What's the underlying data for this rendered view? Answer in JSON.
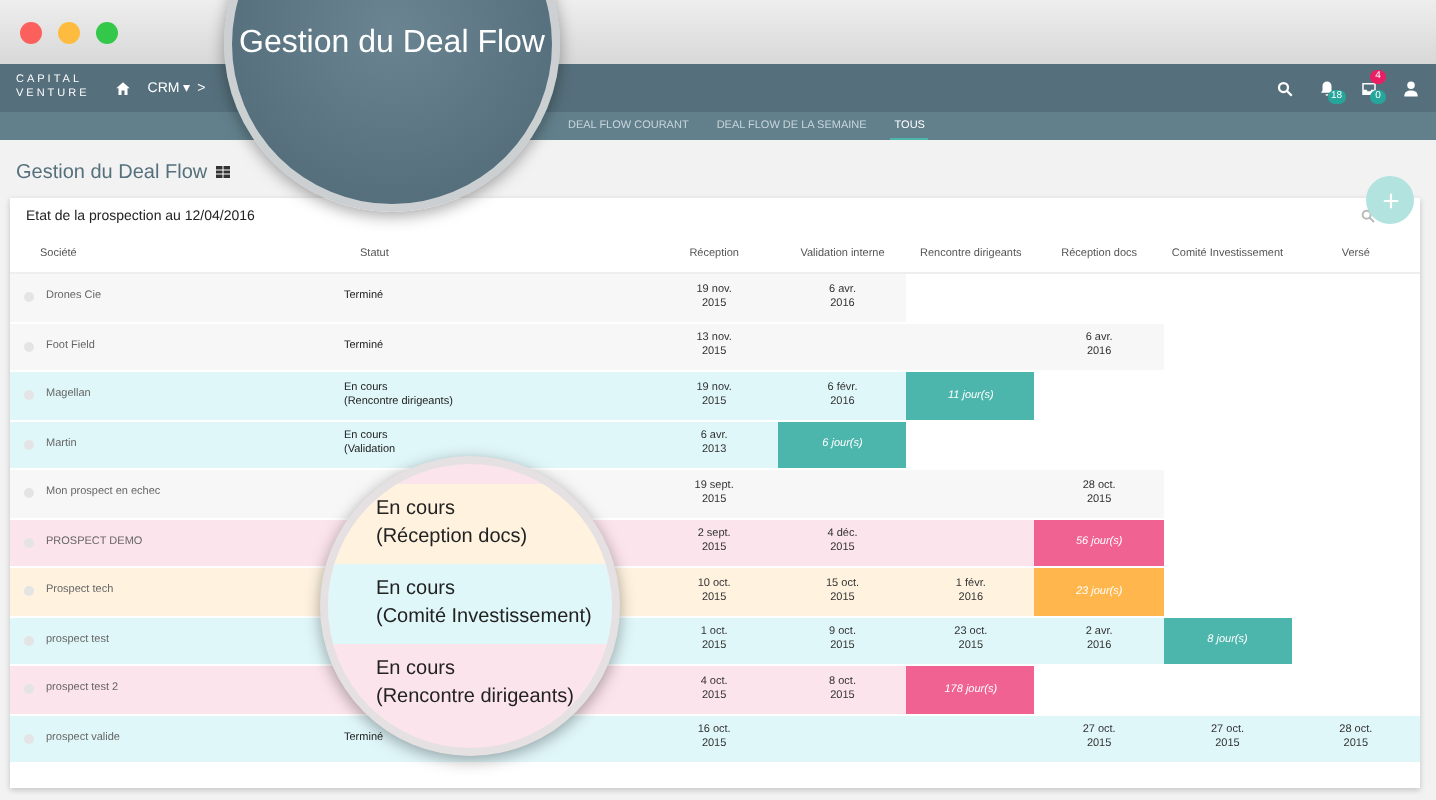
{
  "logo": {
    "line_1": "CAPITAL",
    "line_2": "VENTURE"
  },
  "breadcrumb": [
    {
      "label": "CRM ▾"
    },
    {
      "label": ">"
    }
  ],
  "nav_badges": {
    "notifications": "18",
    "messages_new": "4",
    "messages_count": "0"
  },
  "tabs": [
    {
      "label": "DEAL FLOW COURANT",
      "selected": false
    },
    {
      "label": "DEAL FLOW DE LA SEMAINE",
      "selected": false
    },
    {
      "label": "TOUS",
      "selected": true
    }
  ],
  "page_title": "Gestion du Deal Flow",
  "card": {
    "title": "Etat de la prospection au 12/04/2016",
    "columns": [
      "Société",
      "Statut",
      "Réception",
      "Validation interne",
      "Rencontre dirigeants",
      "Réception docs",
      "Comité Investissement",
      "Versé"
    ],
    "rows": [
      {
        "color": "#f7f7f7",
        "cells": [
          {
            "kind": "name",
            "text": "Drones Cie"
          },
          {
            "kind": "status",
            "text": "Terminé"
          },
          {
            "kind": "date",
            "text": "19 nov.\n2015"
          },
          {
            "kind": "date",
            "text": "6 avr.\n2016"
          },
          {
            "kind": "none"
          },
          {
            "kind": "none"
          },
          {
            "kind": "none"
          },
          {
            "kind": "none"
          }
        ]
      },
      {
        "color": "#f7f7f7",
        "cells": [
          {
            "kind": "name",
            "text": "Foot Field"
          },
          {
            "kind": "status",
            "text": "Terminé"
          },
          {
            "kind": "date",
            "text": "13 nov.\n2015"
          },
          {
            "kind": "blank"
          },
          {
            "kind": "blank"
          },
          {
            "kind": "date",
            "text": "6 avr.\n2016"
          },
          {
            "kind": "none"
          },
          {
            "kind": "none"
          }
        ]
      },
      {
        "color": "#e0f7fa",
        "cells": [
          {
            "kind": "name",
            "text": "Magellan"
          },
          {
            "kind": "status",
            "text": "En cours\n(Rencontre dirigeants)"
          },
          {
            "kind": "date",
            "text": "19 nov.\n2015"
          },
          {
            "kind": "date",
            "text": "6 févr.\n2016"
          },
          {
            "kind": "badge",
            "text": "11 jour(s)",
            "color": "#4db6ac"
          },
          {
            "kind": "none"
          },
          {
            "kind": "none"
          },
          {
            "kind": "none"
          }
        ]
      },
      {
        "color": "#e0f7fa",
        "cells": [
          {
            "kind": "name",
            "text": "Martin"
          },
          {
            "kind": "status",
            "text": "En cours\n(Validation"
          },
          {
            "kind": "date",
            "text": "6 avr.\n2013"
          },
          {
            "kind": "badge",
            "text": "6 jour(s)",
            "color": "#4db6ac"
          },
          {
            "kind": "none"
          },
          {
            "kind": "none"
          },
          {
            "kind": "none"
          },
          {
            "kind": "none"
          }
        ]
      },
      {
        "color": "#f7f7f7",
        "cells": [
          {
            "kind": "name",
            "text": "Mon prospect en echec"
          },
          {
            "kind": "status"
          },
          {
            "kind": "date",
            "text": "19 sept.\n2015"
          },
          {
            "kind": "blank"
          },
          {
            "kind": "blank"
          },
          {
            "kind": "date",
            "text": "28 oct.\n2015"
          },
          {
            "kind": "none"
          },
          {
            "kind": "none"
          }
        ]
      },
      {
        "color": "#fce4ec",
        "cells": [
          {
            "kind": "name",
            "text": "PROSPECT DEMO"
          },
          {
            "kind": "status"
          },
          {
            "kind": "date",
            "text": "2 sept.\n2015"
          },
          {
            "kind": "date",
            "text": "4 déc.\n2015"
          },
          {
            "kind": "blank"
          },
          {
            "kind": "badge",
            "text": "56 jour(s)",
            "color": "#f06292"
          },
          {
            "kind": "none"
          },
          {
            "kind": "none"
          }
        ]
      },
      {
        "color": "#fff3e0",
        "cells": [
          {
            "kind": "name",
            "text": "Prospect tech"
          },
          {
            "kind": "status"
          },
          {
            "kind": "date",
            "text": "10 oct.\n2015"
          },
          {
            "kind": "date",
            "text": "15 oct.\n2015"
          },
          {
            "kind": "date",
            "text": "1 févr.\n2016"
          },
          {
            "kind": "badge",
            "text": "23 jour(s)",
            "color": "#ffb74d"
          },
          {
            "kind": "none"
          },
          {
            "kind": "none"
          }
        ]
      },
      {
        "color": "#e0f7fa",
        "cells": [
          {
            "kind": "name",
            "text": "prospect test"
          },
          {
            "kind": "status"
          },
          {
            "kind": "date",
            "text": "1 oct.\n2015"
          },
          {
            "kind": "date",
            "text": "9 oct.\n2015"
          },
          {
            "kind": "date",
            "text": "23 oct.\n2015"
          },
          {
            "kind": "date",
            "text": "2 avr.\n2016"
          },
          {
            "kind": "badge",
            "text": "8 jour(s)",
            "color": "#4db6ac"
          },
          {
            "kind": "none"
          }
        ]
      },
      {
        "color": "#fce4ec",
        "cells": [
          {
            "kind": "name",
            "text": "prospect test 2"
          },
          {
            "kind": "status"
          },
          {
            "kind": "date",
            "text": "4 oct.\n2015"
          },
          {
            "kind": "date",
            "text": "8 oct.\n2015"
          },
          {
            "kind": "badge",
            "text": "178 jour(s)",
            "color": "#f06292"
          },
          {
            "kind": "none"
          },
          {
            "kind": "none"
          },
          {
            "kind": "none"
          }
        ]
      },
      {
        "color": "#e0f7fa",
        "cells": [
          {
            "kind": "name",
            "text": "prospect valide"
          },
          {
            "kind": "status",
            "text": "Terminé"
          },
          {
            "kind": "date",
            "text": "16 oct.\n2015"
          },
          {
            "kind": "blank"
          },
          {
            "kind": "blank"
          },
          {
            "kind": "date",
            "text": "27 oct.\n2015"
          },
          {
            "kind": "date",
            "text": "27 oct.\n2015"
          },
          {
            "kind": "date",
            "text": "28 oct.\n2015"
          }
        ]
      }
    ]
  },
  "magnifier_title": "Gestion du Deal Flow",
  "magnifier_statuses": [
    {
      "text": "En cours\n(Réception docs)",
      "color": "#fff3e0"
    },
    {
      "text": "En cours\n(Comité Investissement)",
      "color": "#e0f7fa"
    },
    {
      "text": "En cours\n(Rencontre dirigeants)",
      "color": "#fce4ec"
    }
  ]
}
